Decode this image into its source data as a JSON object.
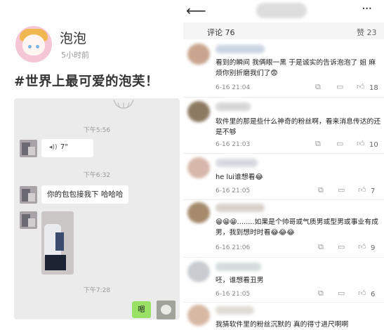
{
  "left_post": {
    "username": "泡泡",
    "time": "5小时前",
    "text": "#世界上最可爱的泡芙！",
    "chat": {
      "timestamps": [
        "下午5:56",
        "下午6:32",
        "下午7:28"
      ],
      "voice_length": "7\"",
      "message": "你的包包接我下 哈哈哈",
      "reply": "嗯"
    }
  },
  "right_panel": {
    "tabs": {
      "comments": "评论 76",
      "likes": "赞 23"
    },
    "comments": [
      {
        "text": "看到的瞬间 我俩眼一黑 于是诚实的告诉泡泡了 姐 麻烦你别折磨我们了😨",
        "time": "6-16 21:04",
        "likes": "18"
      },
      {
        "text": "软件里的那是些什么神奇的粉丝啊，看来消息传达的还是不够",
        "time": "6-16 21:03",
        "likes": "10"
      },
      {
        "text": "he lui谁想看😂",
        "time": "6-16 21:05",
        "likes": "7"
      },
      {
        "text": "😁😁😁........如果是个帅哥或气质男或型男或事业有成男，我到想时时看😂😂😂",
        "time": "6-16 21:06",
        "likes": "9"
      },
      {
        "text": "呸，谁想看丑男",
        "time": "6-16 21:05",
        "likes": "6"
      },
      {
        "text": "我猜软件里的粉丝沉默的 真的得寸进尺啊啊",
        "time": "",
        "likes": ""
      }
    ]
  },
  "icons": [
    "back-arrow-icon",
    "more-icon",
    "share-icon",
    "comment-icon",
    "like-icon",
    "voice-icon"
  ],
  "colors": {
    "chat_bg": "#ebebeb",
    "my_bubble": "#98e165",
    "background": "#ffffff"
  }
}
